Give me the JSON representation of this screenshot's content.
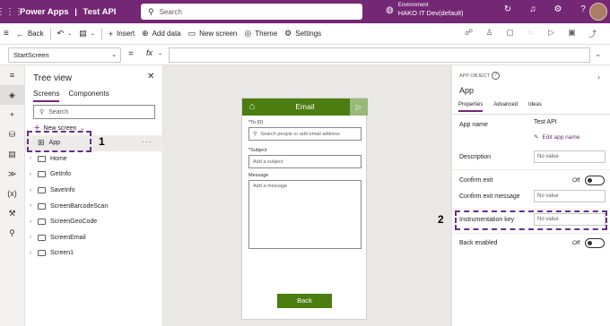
{
  "header": {
    "app_name": "Power Apps",
    "separator": "|",
    "doc_title": "Test API",
    "search_placeholder": "Search",
    "env_label": "Environment",
    "env_name": "HAKO IT Dev(default)"
  },
  "commandbar": {
    "back": "Back",
    "insert": "Insert",
    "add_data": "Add data",
    "new_screen": "New screen",
    "theme": "Theme",
    "settings": "Settings"
  },
  "formula": {
    "property": "StartScreen",
    "equals": "=",
    "fx": "fx"
  },
  "treeview": {
    "title": "Tree view",
    "tabs": [
      "Screens",
      "Components"
    ],
    "search_placeholder": "Search",
    "new_screen": "New screen",
    "app_item": "App",
    "screens": [
      "Home",
      "GetInfo",
      "SaveInfo",
      "ScreenBarcodeScan",
      "ScreenGeoCode",
      "ScreenEmail",
      "Screen1"
    ]
  },
  "annotations": {
    "one": "1",
    "two": "2"
  },
  "phone": {
    "title": "Email",
    "to_label": "*To (0)",
    "to_placeholder": "Search people or add email address",
    "subject_label": "*Subject",
    "subject_placeholder": "Add a subject",
    "message_label": "Message",
    "message_placeholder": "Add a message",
    "back_button": "Back"
  },
  "properties": {
    "kicker": "APP OBJECT",
    "object_name": "App",
    "tabs": [
      "Properties",
      "Advanced",
      "Ideas"
    ],
    "app_name_label": "App name",
    "app_name_value": "Test API",
    "edit_app_name": "Edit app name",
    "description_label": "Description",
    "description_placeholder": "No value",
    "confirm_exit_label": "Confirm exit",
    "confirm_exit_state": "Off",
    "confirm_exit_msg_label": "Confirm exit message",
    "confirm_exit_msg_placeholder": "No value",
    "instrumentation_label": "Instrumentation key",
    "instrumentation_placeholder": "No value",
    "back_enabled_label": "Back enabled",
    "back_enabled_state": "Off"
  },
  "colors": {
    "brand": "#742774",
    "screen_header": "#4b7d10",
    "annotation": "#6a2d8a"
  }
}
